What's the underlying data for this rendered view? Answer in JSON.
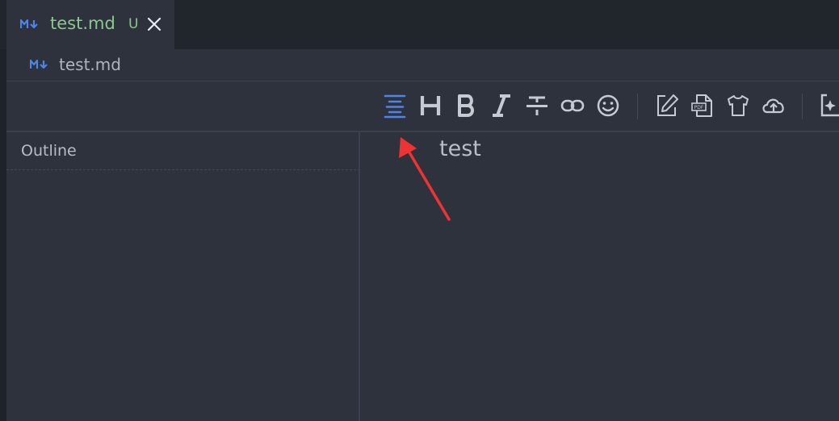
{
  "tab": {
    "filename": "test.md",
    "status": "U"
  },
  "breadcrumb": {
    "filename": "test.md"
  },
  "outline": {
    "title": "Outline"
  },
  "editor": {
    "content": "test"
  },
  "colors": {
    "accent": "#4d84e8",
    "annotation": "#ee3333",
    "tab_text": "#89c98b"
  }
}
